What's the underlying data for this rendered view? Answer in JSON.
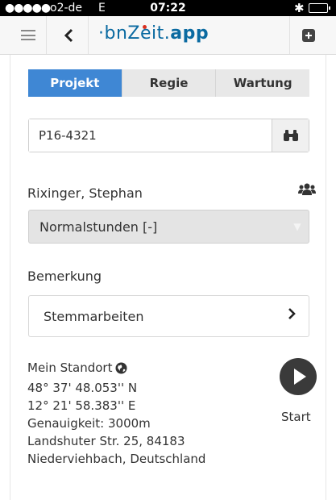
{
  "status_bar": {
    "signal": "●●●●●",
    "carrier": "o2-de",
    "network": "E",
    "time": "07:22",
    "bluetooth": "✱"
  },
  "navbar": {
    "brand_prefix": "·bnZ",
    "brand_e": "e",
    "brand_rest": "it.",
    "brand_app": "app",
    "back_icon": "chevron-left-icon",
    "menu_icon": "hamburger-icon",
    "add_icon": "plus-square-icon"
  },
  "tabs": [
    {
      "label": "Projekt",
      "active": true
    },
    {
      "label": "Regie",
      "active": false
    },
    {
      "label": "Wartung",
      "active": false
    }
  ],
  "search": {
    "value": "P16-4321",
    "icon": "binoculars-icon"
  },
  "person": {
    "name": "Rixinger, Stephan",
    "icon": "group-icon"
  },
  "hours_select": {
    "selected": "Normalstunden [-]"
  },
  "remark": {
    "label": "Bemerkung",
    "value": "Stemmarbeiten"
  },
  "location": {
    "title": "Mein Standort",
    "lat": "48° 37' 48.053'' N",
    "lon": "12° 21' 58.383'' E",
    "accuracy": "Genauigkeit: 3000m",
    "street": "Landshuter Str. 25, 84183",
    "city": "Niederviehbach, Deutschland"
  },
  "start": {
    "label": "Start"
  },
  "colors": {
    "accent": "#3f87d4",
    "brand": "#0a6aa1",
    "brand_dot": "#d9301f"
  }
}
